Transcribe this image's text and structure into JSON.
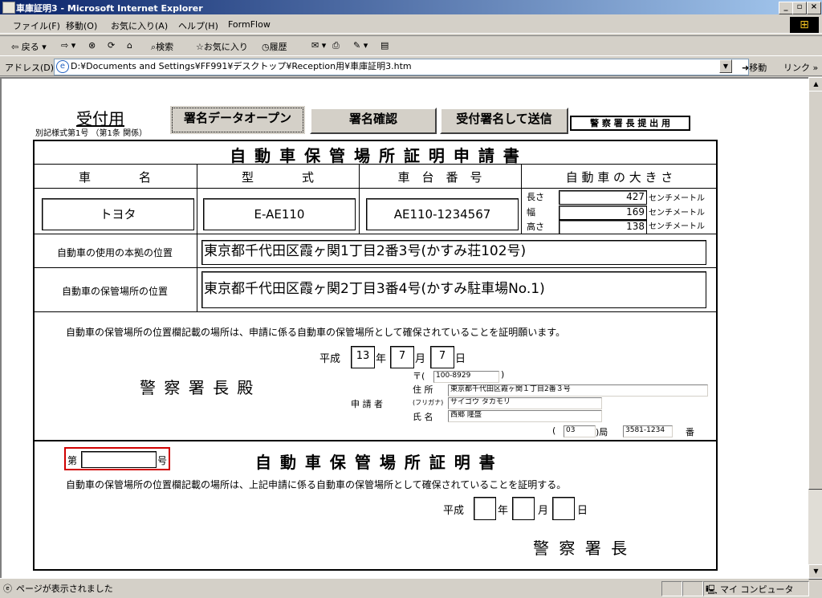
{
  "window": {
    "title": "車庫証明3 - Microsoft Internet Explorer"
  },
  "menu": [
    "ファイル(F)",
    "移動(O)",
    "お気に入り(A)",
    "ヘルプ(H)",
    "FormFlow"
  ],
  "toolbar": {
    "back": "戻る",
    "search": "検索",
    "favorites": "お気に入り",
    "history": "履歴"
  },
  "address": {
    "label": "アドレス(D)",
    "url": "D:¥Documents and Settings¥FF991¥デスクトップ¥Reception用¥車庫証明3.htm",
    "go": "移動",
    "links": "リンク"
  },
  "form": {
    "header": {
      "uketsuke": "受付用",
      "sub": "別記様式第1号 （第1条 関係）",
      "btn_open": "署名データオープン",
      "btn_confirm": "署名確認",
      "btn_send": "受付署名して送信",
      "submit_tag": "警 察 署 長 提 出 用"
    },
    "app_title": "自 動 車 保 管 場 所 証 明 申 請 書",
    "col_headers": [
      "車　　　　名",
      "型　　　　式",
      "車　台　番　号",
      "自 動 車 の 大 き さ"
    ],
    "vehicle": {
      "name": "トヨタ",
      "type": "E-AE110",
      "chassis": "AE110-1234567"
    },
    "size": {
      "length_label": "長さ",
      "length": "427",
      "width_label": "幅",
      "width": "169",
      "height_label": "高さ",
      "height": "138",
      "unit": "センチメートル"
    },
    "usage_label": "自動車の使用の本拠の位置",
    "usage_value": "東京都千代田区霞ヶ関1丁目2番3号(かすみ荘102号)",
    "storage_label": "自動車の保管場所の位置",
    "storage_value": "東京都千代田区霞ヶ関2丁目3番4号(かすみ駐車場No.1)",
    "app_statement": "自動車の保管場所の位置欄記載の場所は、申請に係る自動車の保管場所として確保されていることを証明願います。",
    "app_date": {
      "era": "平成",
      "year": "13",
      "y": "年",
      "month": "7",
      "m": "月",
      "day": "7",
      "d": "日"
    },
    "police_chief": "警 察 署 長 殿",
    "applicant": {
      "label": "申 請 者",
      "postal_mark": "〒(",
      "postal": "100-8929",
      "postal_close": ")",
      "addr_label": "住 所",
      "address": "東京都千代田区霞ヶ関１丁目2番３号",
      "kana_label": "(フリガナ)",
      "kana": "サイゴウ タカモリ",
      "name_label": "氏 名",
      "name": "西郷 隆盛",
      "phone_open": "(",
      "phone_area": "03",
      "phone_mid": ")局",
      "phone_num": "3581-1234",
      "phone_ban": "番"
    },
    "cert": {
      "dai": "第",
      "go": "号",
      "title": "自 動 車 保 管 場 所 証 明 書",
      "statement": "自動車の保管場所の位置欄記載の場所は、上記申請に係る自動車の保管場所として確保されていることを証明する。",
      "era": "平成",
      "y": "年",
      "m": "月",
      "d": "日",
      "chief": "警 察 署 長"
    }
  },
  "status": {
    "text": "ページが表示されました",
    "zone": "マイ コンピュータ"
  }
}
